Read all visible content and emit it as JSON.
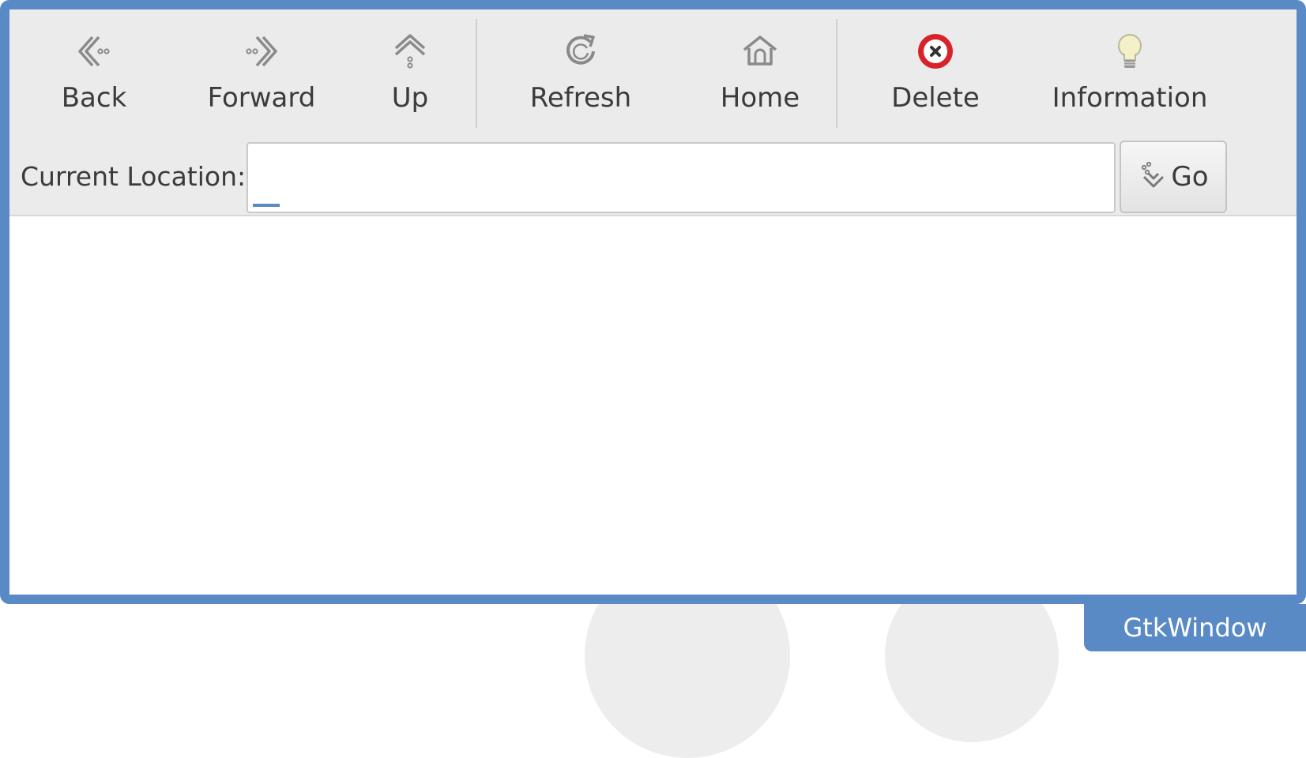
{
  "window": {
    "title_tag": "GtkWindow"
  },
  "toolbar": {
    "items": [
      {
        "label": "Back",
        "icon": "back-arrow-icon"
      },
      {
        "label": "Forward",
        "icon": "forward-arrow-icon"
      },
      {
        "label": "Up",
        "icon": "up-arrow-icon"
      },
      {
        "label": "Refresh",
        "icon": "refresh-icon"
      },
      {
        "label": "Home",
        "icon": "home-icon"
      },
      {
        "label": "Delete",
        "icon": "delete-icon"
      },
      {
        "label": "Information",
        "icon": "lightbulb-icon"
      }
    ]
  },
  "location": {
    "label": "Current Location:",
    "value": "",
    "go_label": "Go",
    "go_icon": "go-jump-icon"
  },
  "colors": {
    "accent": "#5a8ac6",
    "toolbar_bg": "#ebebeb",
    "delete_red": "#d9232a"
  }
}
